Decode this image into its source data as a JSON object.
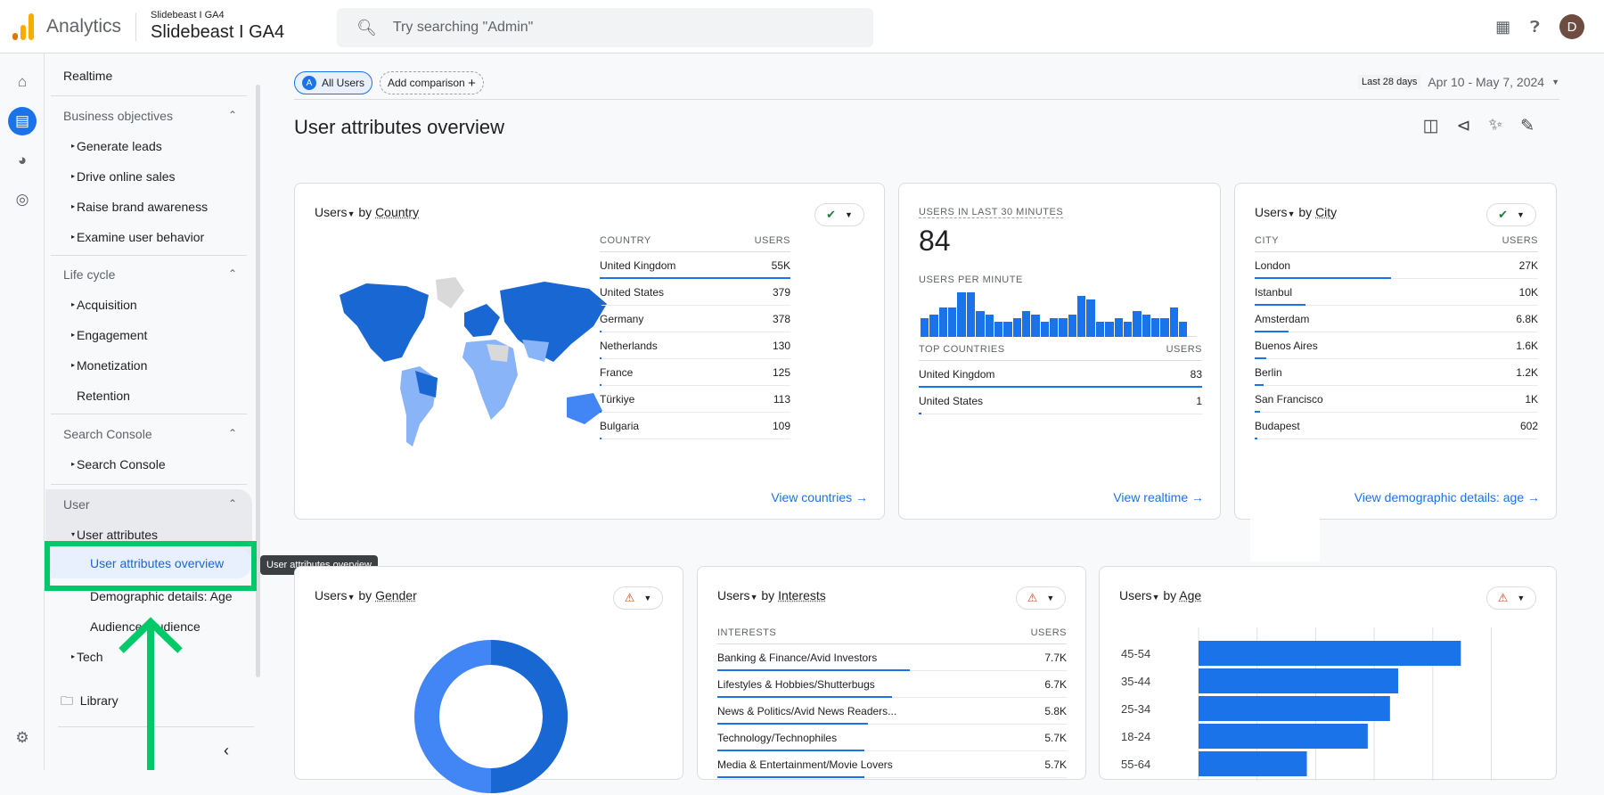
{
  "topbar": {
    "app_name": "Analytics",
    "account": "Slidebeast I GA4",
    "property": "Slidebeast I GA4",
    "search_placeholder": "Try searching \"Admin\"",
    "avatar_letter": "D"
  },
  "nav": {
    "realtime": "Realtime",
    "sections": [
      {
        "label": "Business objectives",
        "items": [
          "Generate leads",
          "Drive online sales",
          "Raise brand awareness",
          "Examine user behavior"
        ]
      },
      {
        "label": "Life cycle",
        "items": [
          "Acquisition",
          "Engagement",
          "Monetization",
          "Retention"
        ]
      },
      {
        "label": "Search Console",
        "items": [
          "Search Console"
        ]
      },
      {
        "label": "User",
        "items": [
          "User attributes",
          "User attributes overview",
          "Demographic details: Age",
          "Audience: Audience",
          "Tech"
        ]
      }
    ],
    "library": "Library",
    "tooltip": "User attributes overview"
  },
  "main": {
    "segment": "All Users",
    "segment_letter": "A",
    "add_comparison": "Add comparison",
    "date_preset": "Last 28 days",
    "date_range": "Apr 10 - May 7, 2024",
    "title": "User attributes overview"
  },
  "country_card": {
    "metric": "Users",
    "by": "by",
    "dimension": "Country",
    "col1": "COUNTRY",
    "col2": "USERS",
    "rows": [
      {
        "name": "United Kingdom",
        "value": "55K",
        "pct": 100
      },
      {
        "name": "United States",
        "value": "379",
        "pct": 1
      },
      {
        "name": "Germany",
        "value": "378",
        "pct": 1
      },
      {
        "name": "Netherlands",
        "value": "130",
        "pct": 0.5
      },
      {
        "name": "France",
        "value": "125",
        "pct": 0.5
      },
      {
        "name": "Türkiye",
        "value": "113",
        "pct": 0.5
      },
      {
        "name": "Bulgaria",
        "value": "109",
        "pct": 0.5
      }
    ],
    "link": "View countries"
  },
  "realtime_card": {
    "label": "USERS IN LAST 30 MINUTES",
    "value": "84",
    "per_minute": "USERS PER MINUTE",
    "col1": "TOP COUNTRIES",
    "col2": "USERS",
    "per_minute_values": [
      5,
      6,
      8,
      8,
      12,
      12,
      7,
      6,
      4,
      4,
      5,
      7,
      6,
      4,
      5,
      5,
      6,
      11,
      10,
      4,
      4,
      5,
      4,
      7,
      6,
      5,
      5,
      8,
      4,
      0
    ],
    "rows": [
      {
        "name": "United Kingdom",
        "value": "83",
        "pct": 100
      },
      {
        "name": "United States",
        "value": "1",
        "pct": 1
      }
    ],
    "link": "View realtime"
  },
  "city_card": {
    "metric": "Users",
    "by": "by",
    "dimension": "City",
    "col1": "CITY",
    "col2": "USERS",
    "rows": [
      {
        "name": "London",
        "value": "27K",
        "pct": 48
      },
      {
        "name": "Istanbul",
        "value": "10K",
        "pct": 18
      },
      {
        "name": "Amsterdam",
        "value": "6.8K",
        "pct": 12
      },
      {
        "name": "Buenos Aires",
        "value": "1.6K",
        "pct": 4
      },
      {
        "name": "Berlin",
        "value": "1.2K",
        "pct": 3
      },
      {
        "name": "San Francisco",
        "value": "1K",
        "pct": 2
      },
      {
        "name": "Budapest",
        "value": "602",
        "pct": 1
      }
    ],
    "link": "View demographic details: age"
  },
  "gender_card": {
    "metric": "Users",
    "by": "by",
    "dimension": "Gender"
  },
  "interests_card": {
    "metric": "Users",
    "by": "by",
    "dimension": "Interests",
    "col1": "INTERESTS",
    "col2": "USERS",
    "rows": [
      {
        "name": "Banking & Finance/Avid Investors",
        "value": "7.7K",
        "pct": 55
      },
      {
        "name": "Lifestyles & Hobbies/Shutterbugs",
        "value": "6.7K",
        "pct": 50
      },
      {
        "name": "News & Politics/Avid News Readers...",
        "value": "5.8K",
        "pct": 43
      },
      {
        "name": "Technology/Technophiles",
        "value": "5.7K",
        "pct": 42
      },
      {
        "name": "Media & Entertainment/Movie Lovers",
        "value": "5.7K",
        "pct": 42
      }
    ]
  },
  "chart_data": {
    "type": "bar",
    "orientation": "horizontal",
    "title": "Users by Age",
    "categories": [
      "45-54",
      "35-44",
      "25-34",
      "18-24",
      "55-64"
    ],
    "values": [
      4.48,
      3.41,
      3.27,
      2.89,
      1.85
    ],
    "grid": true
  },
  "colors": {
    "accent": "#1a73e8",
    "success": "#188038",
    "warning": "#c5501e",
    "annotation": "#00c969"
  }
}
